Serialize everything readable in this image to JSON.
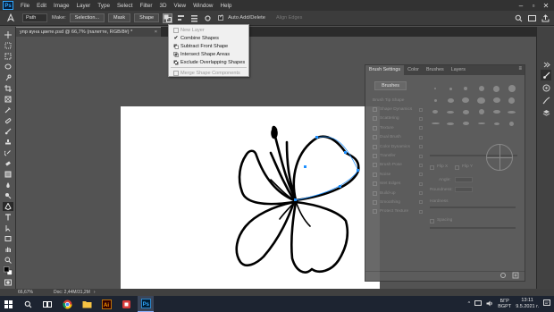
{
  "menubar": {
    "app_logo": "Ps",
    "items": [
      "File",
      "Edit",
      "Image",
      "Layer",
      "Type",
      "Select",
      "Filter",
      "3D",
      "View",
      "Window",
      "Help"
    ]
  },
  "options": {
    "mode_value": "Path",
    "make_label": "Make:",
    "selection_btn": "Selection...",
    "mask_btn": "Mask",
    "shape_btn": "Shape",
    "auto_add_delete": "Auto Add/Delete",
    "align_edges": "Align Edges"
  },
  "document": {
    "tab_title": "упр вуна цвете.psd @ 66,7% (палетте, RGB/8#) *",
    "close": "×"
  },
  "dropdown": {
    "items": [
      {
        "label": "New Layer",
        "enabled": false,
        "checked": false
      },
      {
        "label": "Combine Shapes",
        "enabled": true,
        "checked": true
      },
      {
        "label": "Subtract Front Shape",
        "enabled": true,
        "checked": false
      },
      {
        "label": "Intersect Shape Areas",
        "enabled": true,
        "checked": false
      },
      {
        "label": "Exclude Overlapping Shapes",
        "enabled": true,
        "checked": false
      },
      {
        "label": "Merge Shape Components",
        "enabled": false,
        "checked": false
      }
    ]
  },
  "brush_panel": {
    "tabs": [
      "Brush Settings",
      "Color",
      "Brushes",
      "Layers"
    ],
    "brushes_button": "Brushes",
    "settings": [
      "Brush Tip Shape",
      "Shape Dynamics",
      "Scattering",
      "Texture",
      "Dual Brush",
      "Color Dynamics",
      "Transfer",
      "Brush Pose",
      "Noise",
      "Wet Edges",
      "Build-up",
      "Smoothing",
      "Protect Texture"
    ],
    "labels": {
      "flip_x": "Flip X",
      "flip_y": "Flip Y",
      "angle": "Angle:",
      "roundness": "Roundness:",
      "hardness": "Hardness",
      "spacing": "Spacing"
    }
  },
  "status": {
    "zoom": "66,67%",
    "doc_size": "Doc: 2,44M/31,2M"
  },
  "taskbar": {
    "lang_top": "БГР",
    "lang_bottom": "BGPT",
    "time": "13:11",
    "date": "9.5.2021 г."
  },
  "colors": {
    "accent": "#31a8ff",
    "path_anchor": "#1e90ff",
    "canvas": "#ffffff"
  }
}
